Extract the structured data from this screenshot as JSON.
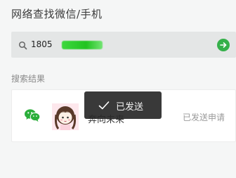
{
  "page": {
    "title": "网络查找微信/手机"
  },
  "search": {
    "value": "1805",
    "icon": "search-icon",
    "redacted_color": "#22c322",
    "go_button_color": "#35b04a"
  },
  "results": {
    "section_label": "搜索结果",
    "items": [
      {
        "name": "奔向未来",
        "status": "已发送申请",
        "source_icon": "wechat-icon",
        "avatar": "cartoon-girl-avatar"
      }
    ]
  },
  "toast": {
    "icon": "check-icon",
    "message": "已发送"
  }
}
